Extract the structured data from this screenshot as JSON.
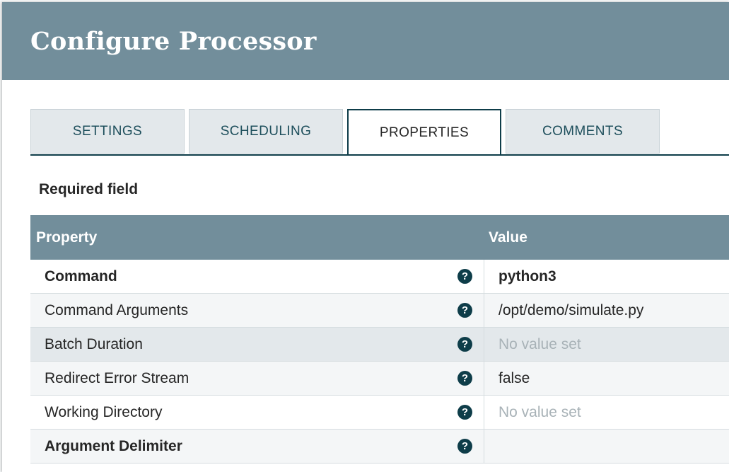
{
  "dialog": {
    "title": "Configure Processor"
  },
  "tabs": [
    {
      "label": "SETTINGS",
      "active": false
    },
    {
      "label": "SCHEDULING",
      "active": false
    },
    {
      "label": "PROPERTIES",
      "active": true
    },
    {
      "label": "COMMENTS",
      "active": false
    }
  ],
  "required_label": "Required field",
  "table": {
    "columns": {
      "property": "Property",
      "value": "Value"
    },
    "help_glyph": "?",
    "rows": [
      {
        "property": "Command",
        "value": "python3",
        "required": true
      },
      {
        "property": "Command Arguments",
        "value": "/opt/demo/simulate.py",
        "required": false
      },
      {
        "property": "Batch Duration",
        "value": "No value set",
        "required": false,
        "empty": true
      },
      {
        "property": "Redirect Error Stream",
        "value": "false",
        "required": false
      },
      {
        "property": "Working Directory",
        "value": "No value set",
        "required": false,
        "empty": true
      },
      {
        "property": "Argument Delimiter",
        "value": "",
        "required": true
      }
    ]
  },
  "colors": {
    "header": "#728e9b",
    "accent": "#0e3d49"
  },
  "icons": {
    "help": "question-circle-icon"
  }
}
